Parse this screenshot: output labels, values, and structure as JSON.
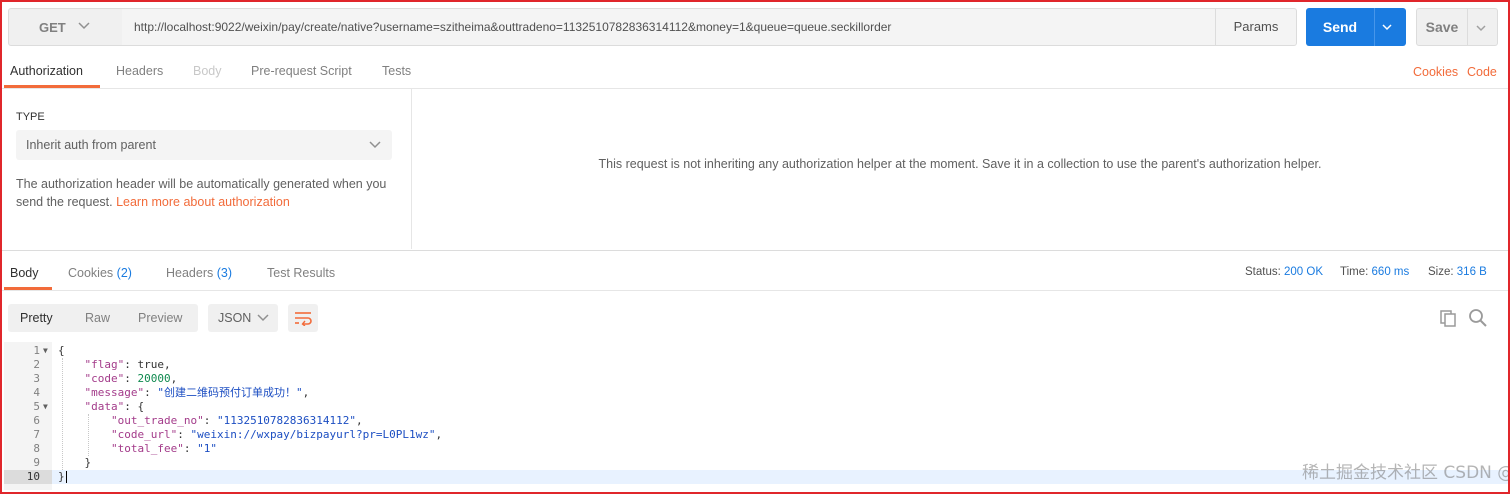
{
  "request": {
    "method": "GET",
    "url": "http://localhost:9022/weixin/pay/create/native?username=szitheima&outtradeno=1132510782836314112&money=1&queue=queue.seckillorder",
    "params_label": "Params",
    "send_label": "Send",
    "save_label": "Save"
  },
  "request_tabs": [
    {
      "label": "Authorization"
    },
    {
      "label": "Headers"
    },
    {
      "label": "Body"
    },
    {
      "label": "Pre-request Script"
    },
    {
      "label": "Tests"
    }
  ],
  "links": {
    "cookies": "Cookies",
    "code": "Code"
  },
  "auth": {
    "type_label": "TYPE",
    "type_value": "Inherit auth from parent",
    "description": "The authorization header will be automatically generated when you send the request. ",
    "link": "Learn more about authorization",
    "message": "This request is not inheriting any authorization helper at the moment. Save it in a collection to use the parent's authorization helper."
  },
  "response_tabs": {
    "body": "Body",
    "cookies": "Cookies",
    "cookies_count": "(2)",
    "headers": "Headers",
    "headers_count": "(3)",
    "tests": "Test Results"
  },
  "status": {
    "status_label": "Status:",
    "status_value": "200 OK",
    "time_label": "Time:",
    "time_value": "660 ms",
    "size_label": "Size:",
    "size_value": "316 B"
  },
  "view_modes": {
    "pretty": "Pretty",
    "raw": "Raw",
    "preview": "Preview"
  },
  "format": "JSON",
  "line_numbers": [
    "1",
    "2",
    "3",
    "4",
    "5",
    "6",
    "7",
    "8",
    "9",
    "10"
  ],
  "code": {
    "l1": "{",
    "flag_key": "\"flag\"",
    "flag_val": "true",
    "code_key": "\"code\"",
    "code_val": "20000",
    "message_key": "\"message\"",
    "message_val": "\"创建二维码预付订单成功！\"",
    "data_key": "\"data\"",
    "otn_key": "\"out_trade_no\"",
    "otn_val": "\"1132510782836314112\"",
    "url_key": "\"code_url\"",
    "url_val": "\"weixin://wxpay/bizpayurl?pr=L0PL1wz\"",
    "fee_key": "\"total_fee\"",
    "fee_val": "\"1\"",
    "l9": "}",
    "l10": "}"
  },
  "watermark": "稀土掘金技术社区 CSDN @JavaEdge."
}
